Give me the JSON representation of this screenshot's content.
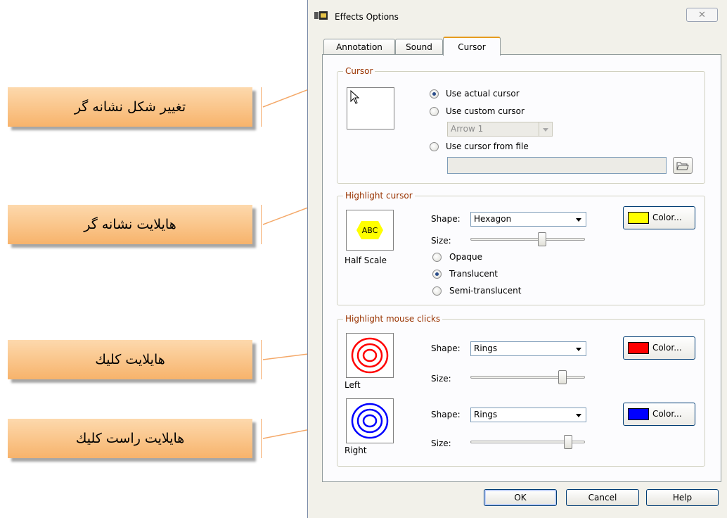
{
  "annotations": [
    {
      "text": "تغيير شكل نشانه گر"
    },
    {
      "text": "هايلايت نشانه گر"
    },
    {
      "text": "هايلايت كليك"
    },
    {
      "text": "هايلايت راست كليك"
    }
  ],
  "window": {
    "title": "Effects Options",
    "close_glyph": "✕"
  },
  "tabs": [
    {
      "label": "Annotation"
    },
    {
      "label": "Sound"
    },
    {
      "label": "Cursor"
    }
  ],
  "active_tab": "Cursor",
  "cursor_group": {
    "title": "Cursor",
    "options": [
      {
        "label": "Use actual cursor",
        "checked": true
      },
      {
        "label": "Use custom cursor",
        "checked": false
      },
      {
        "label": "Use cursor from file",
        "checked": false
      }
    ],
    "custom_cursor_select": "Arrow 1",
    "file_path": ""
  },
  "highlight_cursor": {
    "title": "Highlight cursor",
    "preview_text": "ABC",
    "preview_caption": "Half Scale",
    "shape_label": "Shape:",
    "shape_value": "Hexagon",
    "size_label": "Size:",
    "size_level": 0.72,
    "color_label": "Color...",
    "color": "#ffff00",
    "opacity_options": [
      {
        "label": "Opaque",
        "checked": false
      },
      {
        "label": "Translucent",
        "checked": true
      },
      {
        "label": "Semi-translucent",
        "checked": false
      }
    ]
  },
  "highlight_clicks": {
    "title": "Highlight mouse clicks",
    "left": {
      "caption": "Left",
      "shape_label": "Shape:",
      "shape_value": "Rings",
      "size_label": "Size:",
      "size_level": 0.83,
      "color_label": "Color...",
      "color": "#ff0000"
    },
    "right": {
      "caption": "Right",
      "shape_label": "Shape:",
      "shape_value": "Rings",
      "size_label": "Size:",
      "size_level": 0.87,
      "color_label": "Color...",
      "color": "#0000ff"
    }
  },
  "buttons": {
    "ok": "OK",
    "cancel": "Cancel",
    "help": "Help"
  },
  "colors": {
    "callout_top": "#fdd9ad",
    "callout_bottom": "#f7b36b",
    "group_title": "#993300",
    "dialog_bg": "#f2f1ea"
  }
}
